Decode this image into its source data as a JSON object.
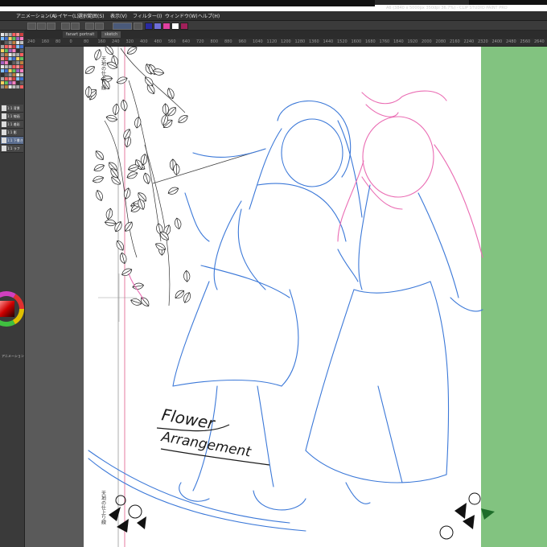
{
  "app": {
    "doc_info": "A6 (3840 x 5000px 350dpi 36.7%) - CLIP STUDIO PAINT PRO"
  },
  "menu": {
    "items": [
      "アニメーション(A)",
      "レイヤー(L)",
      "選択範囲(S)",
      "表示(V)",
      "フィルター(I)",
      "ウィンドウ(W)",
      "ヘルプ(H)"
    ]
  },
  "toolbar": {
    "swatches": [
      "#2a2aa0",
      "#6f6fd8",
      "#e040a0",
      "#ffffff",
      "#a0205a"
    ]
  },
  "tabs": [
    "fanart portrait",
    "sketch"
  ],
  "ruler": {
    "ticks": [
      "240",
      "160",
      "80",
      "0",
      "80",
      "160",
      "240",
      "320",
      "400",
      "480",
      "560",
      "640",
      "720",
      "800",
      "880",
      "960",
      "1040",
      "1120",
      "1200",
      "1280",
      "1360",
      "1440",
      "1520",
      "1600",
      "1680",
      "1760",
      "1840",
      "1920",
      "2000",
      "2080",
      "2160",
      "2240",
      "2320",
      "2400",
      "2480",
      "2560",
      "2640"
    ]
  },
  "left_panel": {
    "layers": [
      "1:1 背景",
      "1:1 線画",
      "1:1 着彩",
      "1:1 影",
      "1:1 下書き",
      "1:1 ラフ"
    ],
    "bottom_label": "アニメーション 96%",
    "color_wheel_label": "カラーサークル"
  },
  "canvas": {
    "paper_note_top": "天地の仕上り線",
    "paper_note_bottom": "天地の仕上り線",
    "title_line1": "Flower",
    "title_line2": "Arrangement"
  },
  "colors": {
    "sketch_blue": "#3b78d8",
    "sketch_pink": "#ea6cb3",
    "green_panel": "#82c380",
    "guide_red": "#e05a8a"
  }
}
